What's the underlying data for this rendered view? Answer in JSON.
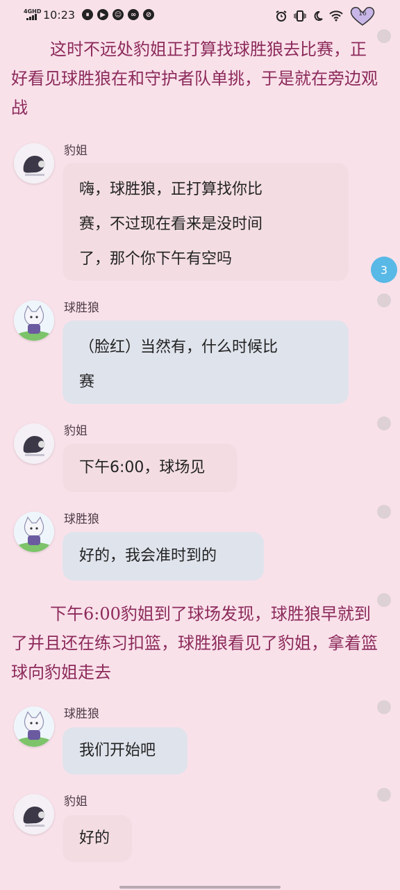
{
  "status_bar": {
    "network": "4GHD",
    "time": "10:23",
    "battery_level": "16"
  },
  "narration": [
    "这时不远处豹姐正打算找球胜狼去比赛，正好看见球胜狼在和守护者队单挑，于是就在旁边观战",
    "下午6:00豹姐到了球场发现，球胜狼早就到了并且还在练习扣篮，球胜狼看见了豹姐，拿着篮球向豹姐走去"
  ],
  "messages": [
    {
      "name": "豹姐",
      "lines": [
        "嗨，球胜狼，正打算找你比",
        "赛，不过现在看来是没时间",
        "了，那个你下午有空吗"
      ]
    },
    {
      "name": "球胜狼",
      "lines": [
        "（脸红）当然有，什么时候比",
        "赛"
      ]
    },
    {
      "name": "豹姐",
      "lines": [
        "下午6:00，球场见"
      ]
    },
    {
      "name": "球胜狼",
      "lines": [
        "好的，我会准时到的"
      ]
    },
    {
      "name": "球胜狼",
      "lines": [
        "我们开始吧"
      ]
    },
    {
      "name": "豹姐",
      "lines": [
        "好的"
      ]
    }
  ],
  "unread_count": "3",
  "colors": {
    "background": "#f9e1ea",
    "narration_text": "#8c2a5a",
    "bubble_pink": "#f3dde2",
    "bubble_blue": "#dfe3ec",
    "badge": "#58b8e6"
  }
}
